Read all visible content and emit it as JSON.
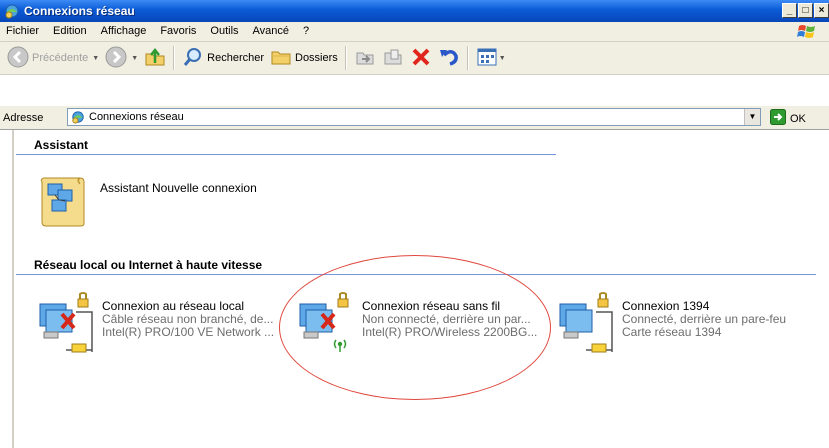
{
  "window": {
    "title": "Connexions réseau",
    "controls": {
      "minimize": "_",
      "maximize": "□",
      "close": "×"
    }
  },
  "menu": [
    "Fichier",
    "Edition",
    "Affichage",
    "Favoris",
    "Outils",
    "Avancé",
    "?"
  ],
  "toolbar": {
    "back_label": "Précédente",
    "search_label": "Rechercher",
    "folders_label": "Dossiers"
  },
  "address": {
    "label": "Adresse",
    "value": "Connexions réseau",
    "go_label": "OK"
  },
  "groups": [
    {
      "title": "Assistant",
      "items": [
        {
          "name": "Assistant Nouvelle connexion",
          "line2": "",
          "line3": ""
        }
      ]
    },
    {
      "title": "Réseau local ou Internet à haute vitesse",
      "items": [
        {
          "name": "Connexion au réseau local",
          "line2": "Câble réseau non branché, de...",
          "line3": "Intel(R) PRO/100 VE Network ..."
        },
        {
          "name": "Connexion réseau sans fil",
          "line2": "Non connecté, derrière un par...",
          "line3": "Intel(R) PRO/Wireless 2200BG..."
        },
        {
          "name": "Connexion 1394",
          "line2": "Connecté, derrière un pare-feu",
          "line3": "Carte réseau 1394"
        }
      ]
    }
  ],
  "colors": {
    "titlebar": "#0a5ad6",
    "group_line": "#7a96df",
    "annotation_ellipse": "#e0483e",
    "disconnected_x": "#d62718"
  }
}
